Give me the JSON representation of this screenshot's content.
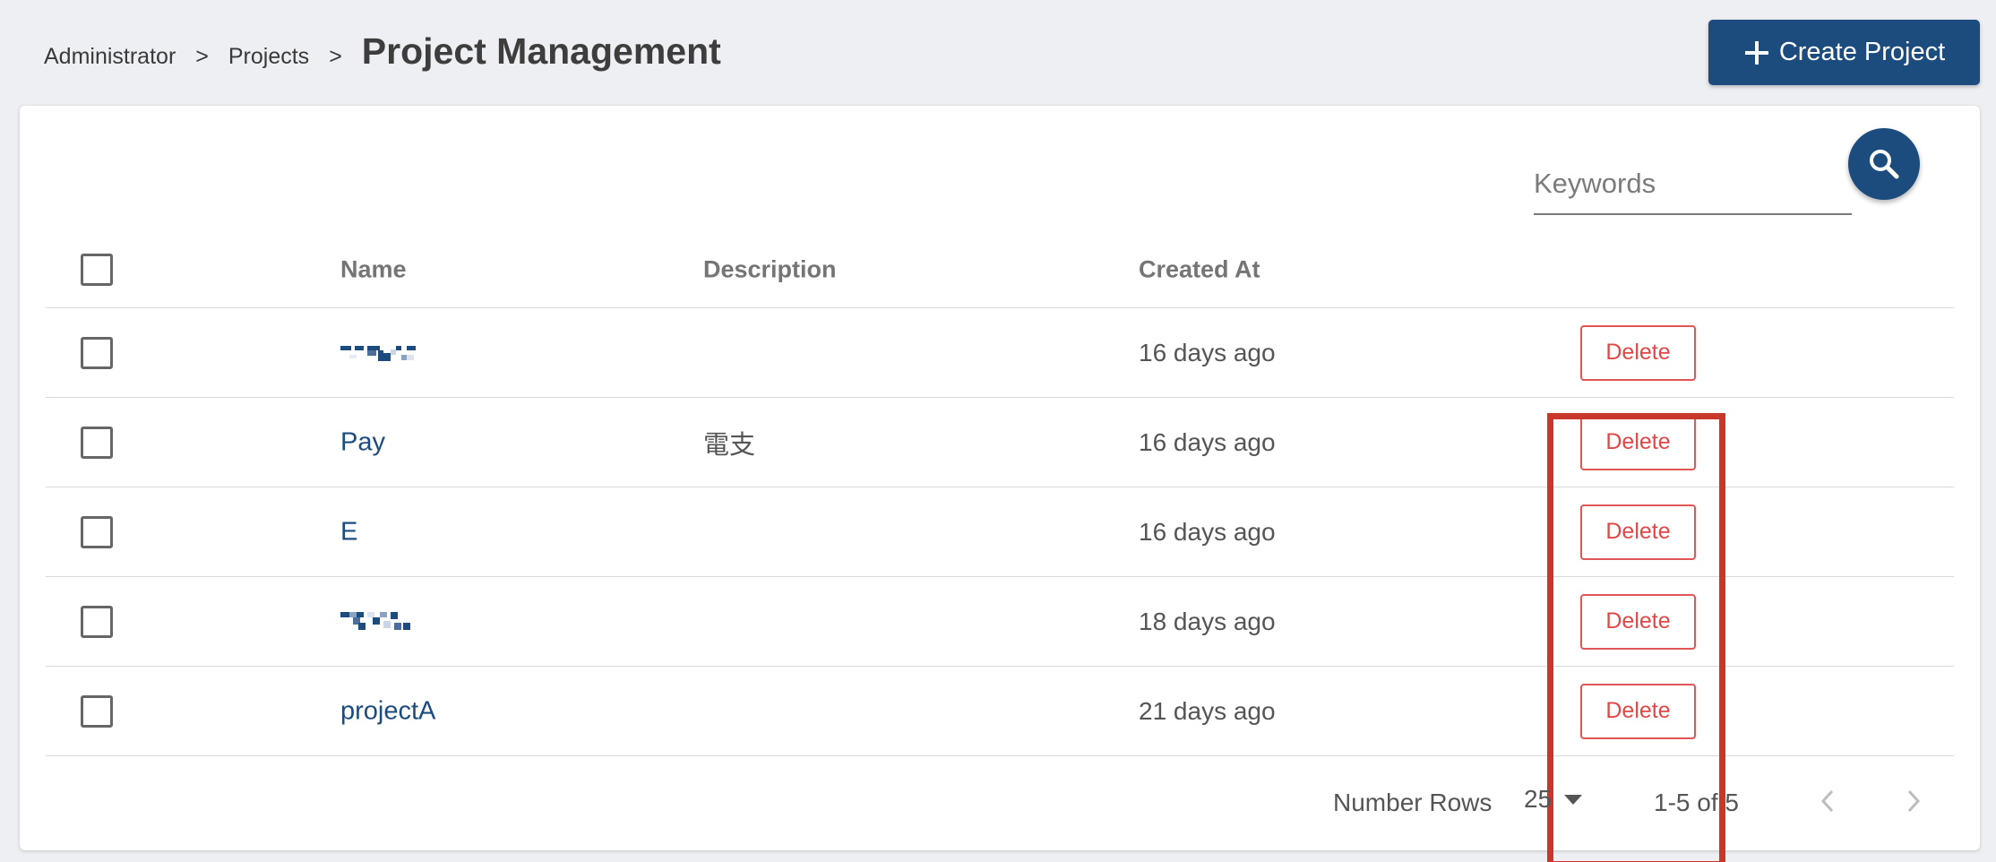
{
  "breadcrumb": {
    "items": [
      "Administrator",
      "Projects"
    ],
    "separator": ">",
    "current": "Project Management"
  },
  "create_button": {
    "label": "Create Project",
    "icon": "plus-icon"
  },
  "search": {
    "placeholder": "Keywords",
    "value": "",
    "icon": "search-icon"
  },
  "table": {
    "columns": {
      "name": "Name",
      "description": "Description",
      "created_at": "Created At"
    },
    "rows": [
      {
        "name": "",
        "name_redacted": true,
        "description": "",
        "created_at": "16 days ago",
        "delete_label": "Delete"
      },
      {
        "name": "Pay",
        "name_redacted": false,
        "description": "電支",
        "created_at": "16 days ago",
        "delete_label": "Delete"
      },
      {
        "name": "E",
        "name_redacted": false,
        "description": "",
        "created_at": "16 days ago",
        "delete_label": "Delete"
      },
      {
        "name": "",
        "name_redacted": true,
        "description": "",
        "created_at": "18 days ago",
        "delete_label": "Delete"
      },
      {
        "name": "projectA",
        "name_redacted": false,
        "description": "",
        "created_at": "21 days ago",
        "delete_label": "Delete"
      }
    ]
  },
  "pagination": {
    "rows_label": "Number Rows",
    "rows_per_page": "25",
    "range": "1-5 of 5"
  },
  "colors": {
    "primary": "#1c4b7e",
    "danger": "#e04848",
    "highlight": "#c9372a",
    "background": "#eeeff3"
  }
}
